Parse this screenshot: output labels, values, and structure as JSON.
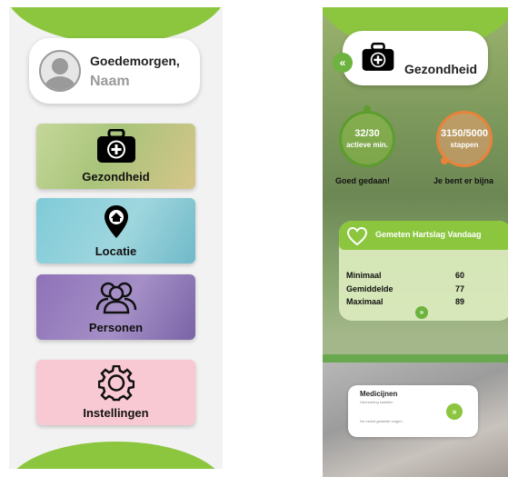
{
  "screen_home": {
    "greeting": "Goedemorgen,",
    "name": "Naam",
    "tiles": [
      {
        "label": "Gezondheid",
        "icon": "first-aid-kit-icon"
      },
      {
        "label": "Locatie",
        "icon": "location-pin-icon"
      },
      {
        "label": "Personen",
        "icon": "people-icon"
      },
      {
        "label": "Instellingen",
        "icon": "gear-icon"
      }
    ]
  },
  "screen_health": {
    "title": "Gezondheid",
    "back_icon": "double-chevron-left-icon",
    "activity": {
      "active_minutes": "32/30",
      "active_unit": "actieve min.",
      "active_caption": "Goed gedaan!",
      "steps": "3150/5000",
      "steps_unit": "stappen",
      "steps_caption": "Je bent er bijna"
    },
    "heart_rate": {
      "title": "Gemeten Hartslag Vandaag",
      "rows": [
        {
          "label": "Minimaal",
          "value": "60"
        },
        {
          "label": "Gemiddelde",
          "value": "77"
        },
        {
          "label": "Maximaal",
          "value": "89"
        }
      ],
      "more_icon": "double-chevron-right-icon"
    },
    "medicines": {
      "title": "Medicijnen",
      "subtitle": "Herinnering instellen",
      "subtitle2": "De meest gestelde vragen"
    }
  },
  "colors": {
    "brand_green": "#8cc63f",
    "tile_health": "#b9cf8a",
    "tile_location": "#8fd0dc",
    "tile_people": "#9880bf",
    "tile_settings": "#f9c9d3"
  }
}
